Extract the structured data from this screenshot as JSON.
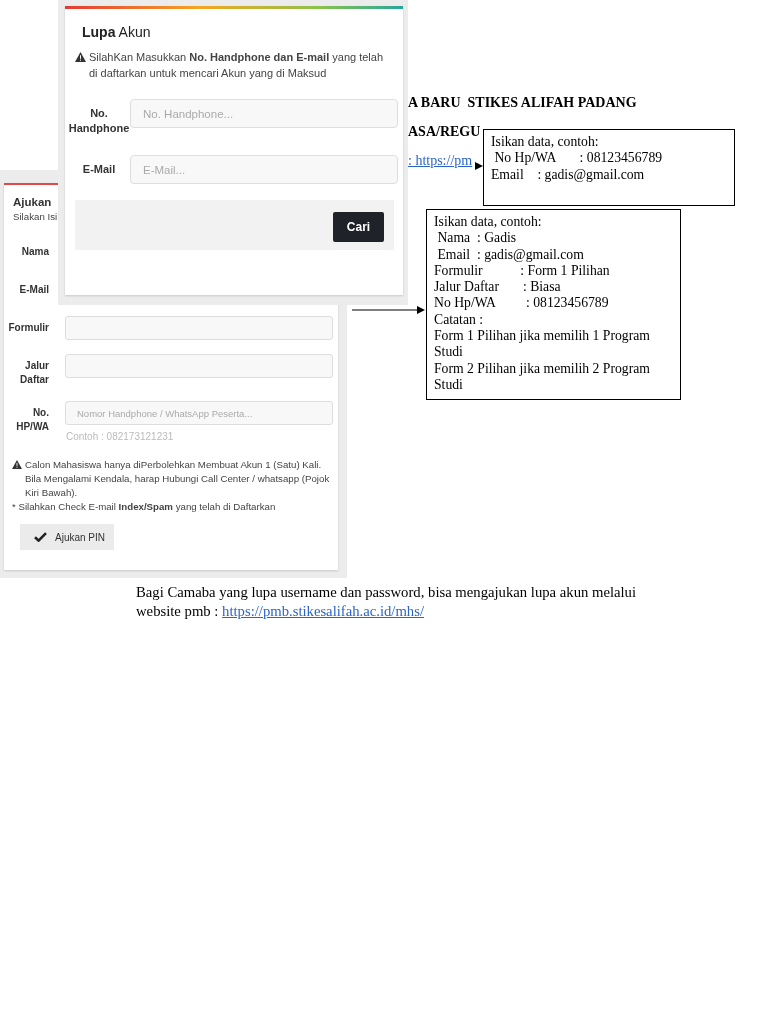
{
  "document": {
    "heading_lines": [
      "A BARU  STIKES ALIFAH PADANG",
      "ASA/REGU"
    ],
    "link_fragment": ": https://pm",
    "paragraph": "Bagi Camaba yang lupa username dan password, bisa mengajukan lupa akun melalui website pmb : ",
    "paragraph_link": "https://pmb.stikesalifah.ac.id/mhs/"
  },
  "registration_screenshot": {
    "title": "Ajukan",
    "subtitle": "Silakan Isi",
    "fields": [
      {
        "label": "Nama",
        "kind": "covered"
      },
      {
        "label": "E-Mail",
        "kind": "covered"
      },
      {
        "label": "Formulir",
        "kind": "input"
      },
      {
        "label": "Jalur Daftar",
        "kind": "input"
      },
      {
        "label": "No. HP/WA",
        "kind": "input",
        "placeholder": "Nomor Handphone / WhatsApp Peserta...",
        "hint": "Contoh : 082173121231"
      }
    ],
    "warning": "Calon Mahasiswa hanya diPerbolehkan Membuat Akun 1 (Satu) Kali. Bila Mengalami Kendala, harap Hubungi Call Center / whatsapp (Pojok Kiri Bawah).",
    "note": "* Silahkan Check E-mail **Index/Spam** yang telah di Daftarkan",
    "button": "Ajukan PIN"
  },
  "forgot_account_screenshot": {
    "title": "**Lupa** Akun",
    "warning": "SilahKan Masukkan **No. Handphone dan E-mail** yang telah di daftarkan untuk mencari Akun yang di Maksud",
    "fields": [
      {
        "label": "No. Handphone",
        "placeholder": "No. Handphone..."
      },
      {
        "label": "E-Mail",
        "placeholder": "E-Mail..."
      }
    ],
    "button": "Cari"
  },
  "callouts": [
    {
      "title": "Isikan data, contoh:",
      "lines": [
        " No Hp/WA       : 08123456789",
        "Email    : gadis@gmail.com"
      ]
    },
    {
      "title": "Isikan data, contoh:",
      "lines": [
        " Nama  : Gadis",
        " Email  : gadis@gmail.com",
        "Formulir           : Form 1 Pilihan",
        "Jalur Daftar       : Biasa",
        "No Hp/WA         : 08123456789",
        "Catatan :",
        "Form 1 Pilihan jika memilih 1 Program Studi",
        "Form 2 Pilihan jika memilih 2 Program Studi"
      ]
    }
  ]
}
